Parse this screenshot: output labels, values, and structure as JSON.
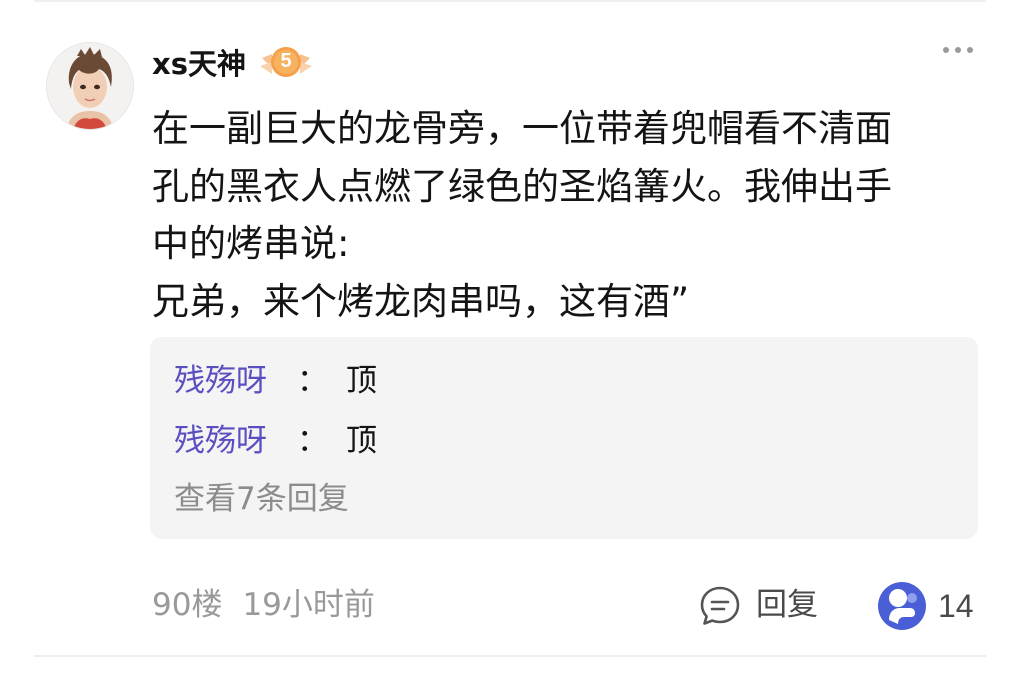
{
  "post": {
    "author": "xs天神",
    "level": "5",
    "text_lines": [
      "在一副巨大的龙骨旁，一位带着兜帽看不清面",
      "孔的黑衣人点燃了绿色的圣焰篝火。我伸出手",
      "中的烤串说:",
      "兄弟，来个烤龙肉串吗，这有酒”"
    ],
    "floor": "90楼",
    "time": "19小时前",
    "reply_label": "回复",
    "like_count": "14"
  },
  "replies": {
    "items": [
      {
        "author": "残殇呀",
        "separator": "：",
        "content": "顶"
      },
      {
        "author": "残殇呀",
        "separator": "：",
        "content": "顶"
      }
    ],
    "view_more": "查看7条回复"
  },
  "colors": {
    "reply_author": "#5a4fc1",
    "badge": "#f5a04a",
    "like_icon": "#4a5fd6",
    "muted": "#999999"
  },
  "icons": {
    "more": "more-dots-icon",
    "reply": "comment-bubble-icon",
    "like": "thumbs-up-icon",
    "badge": "level-badge-icon"
  }
}
